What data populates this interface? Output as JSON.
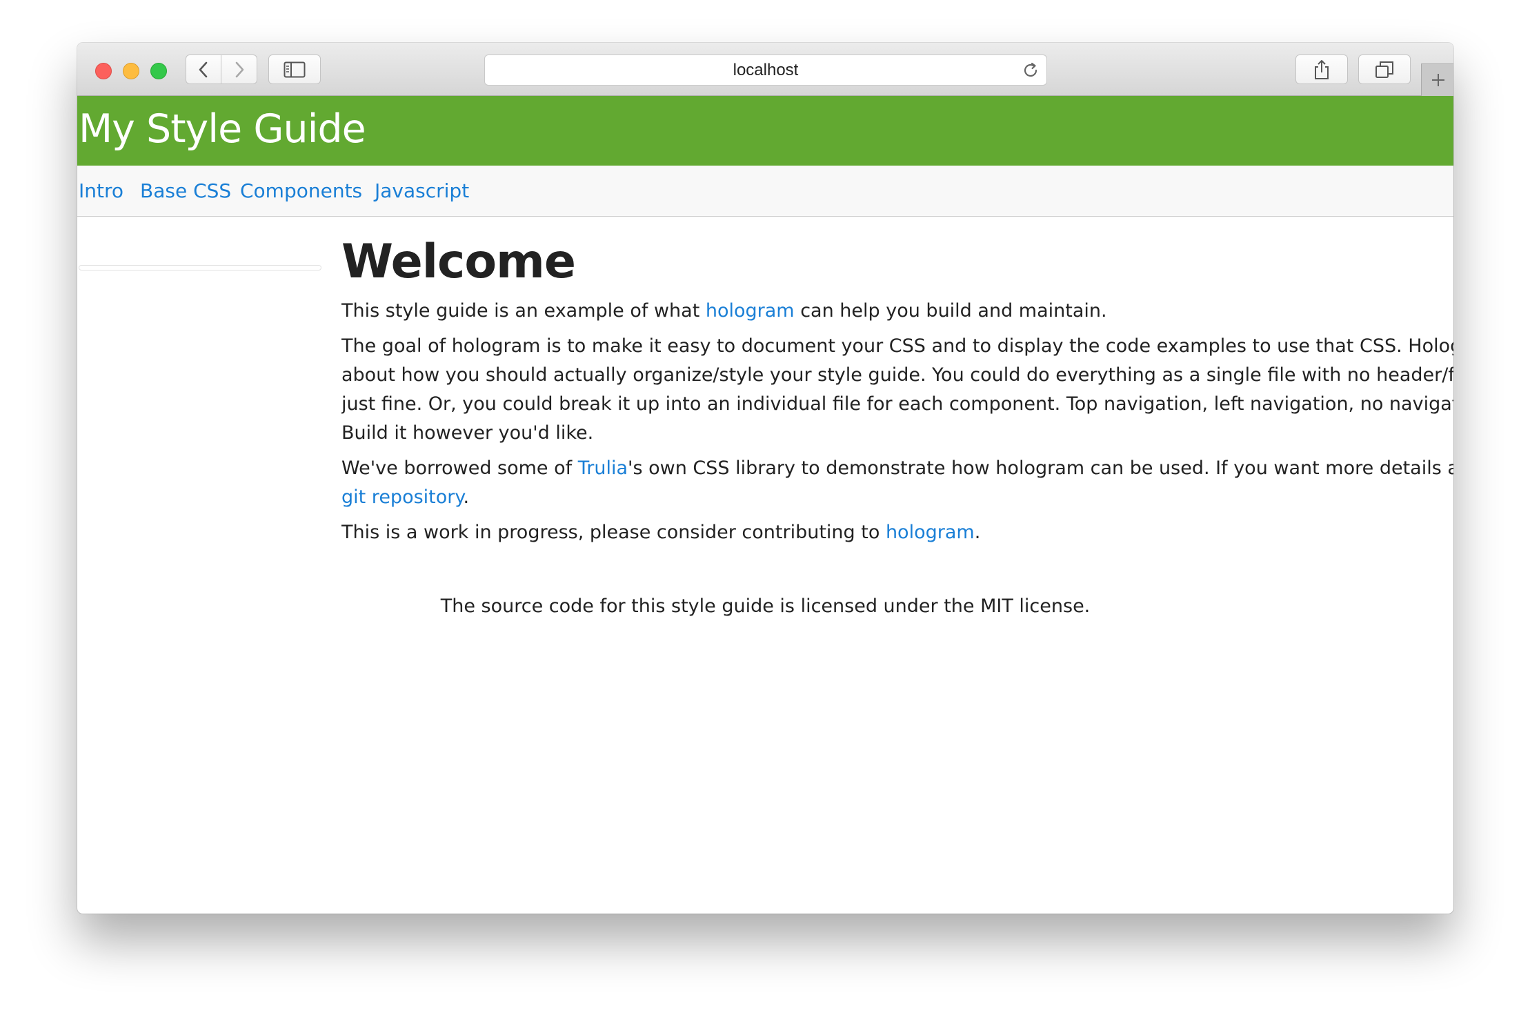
{
  "browser": {
    "url": "localhost",
    "icons": [
      "back-arrow-icon",
      "forward-arrow-icon",
      "sidebar-icon",
      "reload-icon",
      "share-icon",
      "tabs-overview-icon",
      "plus-icon"
    ]
  },
  "header": {
    "title": "My Style Guide",
    "background_color": "#62a931"
  },
  "nav": {
    "items": [
      {
        "label": "Intro"
      },
      {
        "label": "Base CSS"
      },
      {
        "label": "Components"
      },
      {
        "label": "Javascript"
      }
    ],
    "link_color": "#1a7fd6"
  },
  "main": {
    "heading": "Welcome",
    "p1": {
      "before": "This style guide is an example of what ",
      "link": "hologram",
      "after": " can help you build and maintain."
    },
    "p2": {
      "line1": "The goal of hologram is to make it easy to document your CSS and to display the code examples to use that CSS. Hologram h",
      "line2": "about how you should actually organize/style your style guide. You could do everything as a single file with no header/footer",
      "line3": "just fine. Or, you could break it up into an individual file for each component. Top navigation, left navigation, no navigation...",
      "line4": "Build it however you'd like."
    },
    "p3": {
      "before": "We've borrowed some of ",
      "link": "Trulia",
      "after": "'s own CSS library to demonstrate how hologram can be used. If you want more details abou",
      "link2": "git repository",
      "end": "."
    },
    "p4": {
      "before": "This is a work in progress, please consider contributing to ",
      "link": "hologram",
      "after": "."
    }
  },
  "footer": {
    "text": "The source code for this style guide is licensed under the MIT license."
  }
}
